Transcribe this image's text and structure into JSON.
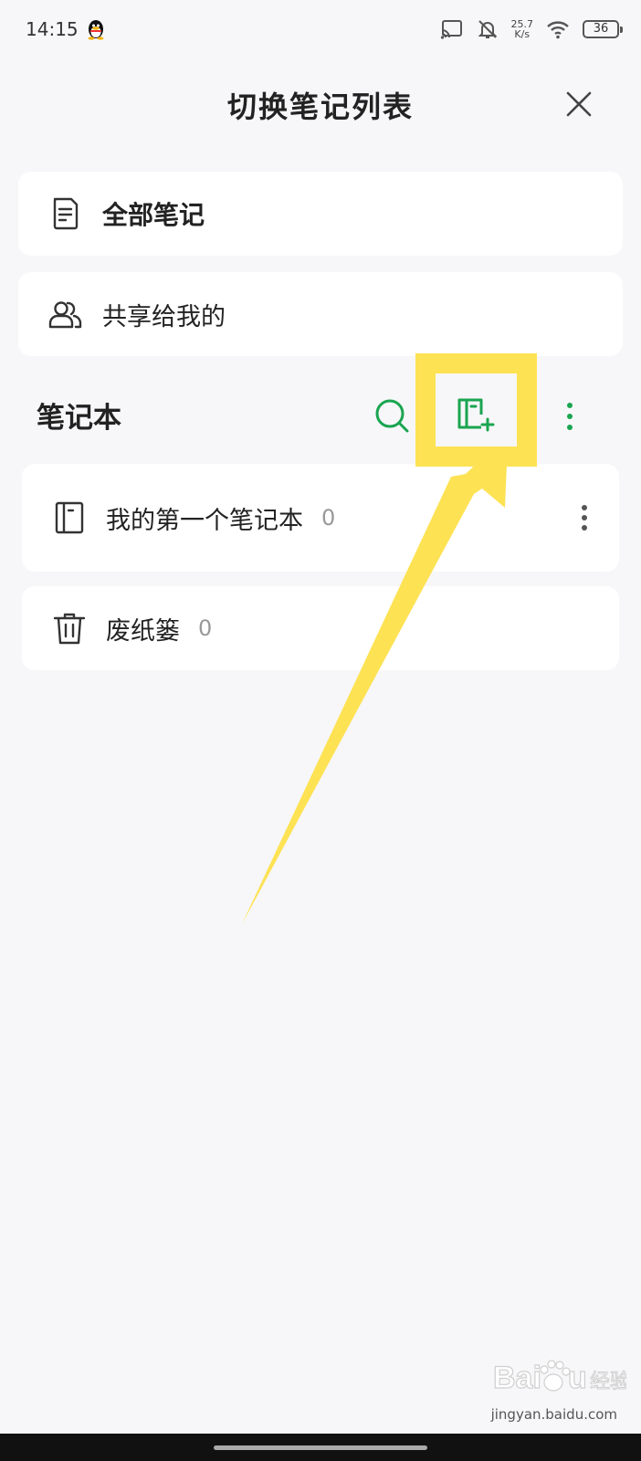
{
  "status_bar": {
    "time": "14:15",
    "net_speed_value": "25.7",
    "net_speed_unit": "K/s",
    "battery": "36",
    "icons": [
      "qq-icon",
      "cast-icon",
      "bell-off-icon",
      "wifi-icon",
      "battery-icon"
    ]
  },
  "header": {
    "title": "切换笔记列表",
    "close_icon": "close-icon"
  },
  "quick_items": [
    {
      "label": "全部笔记",
      "icon": "note-document-icon"
    },
    {
      "label": "共享给我的",
      "icon": "shared-users-icon"
    }
  ],
  "notebooks_section": {
    "title": "笔记本",
    "actions": [
      "search-icon",
      "add-notebook-icon",
      "more-vertical-icon"
    ],
    "accent_color": "#1aa550"
  },
  "notebooks": [
    {
      "label": "我的第一个笔记本",
      "count": "0",
      "icon": "notebook-icon"
    }
  ],
  "trash": {
    "label": "废纸篓",
    "count": "0",
    "icon": "trash-icon"
  },
  "annotation": {
    "highlight_color": "#fde254"
  },
  "watermark": {
    "url": "jingyan.baidu.com"
  }
}
